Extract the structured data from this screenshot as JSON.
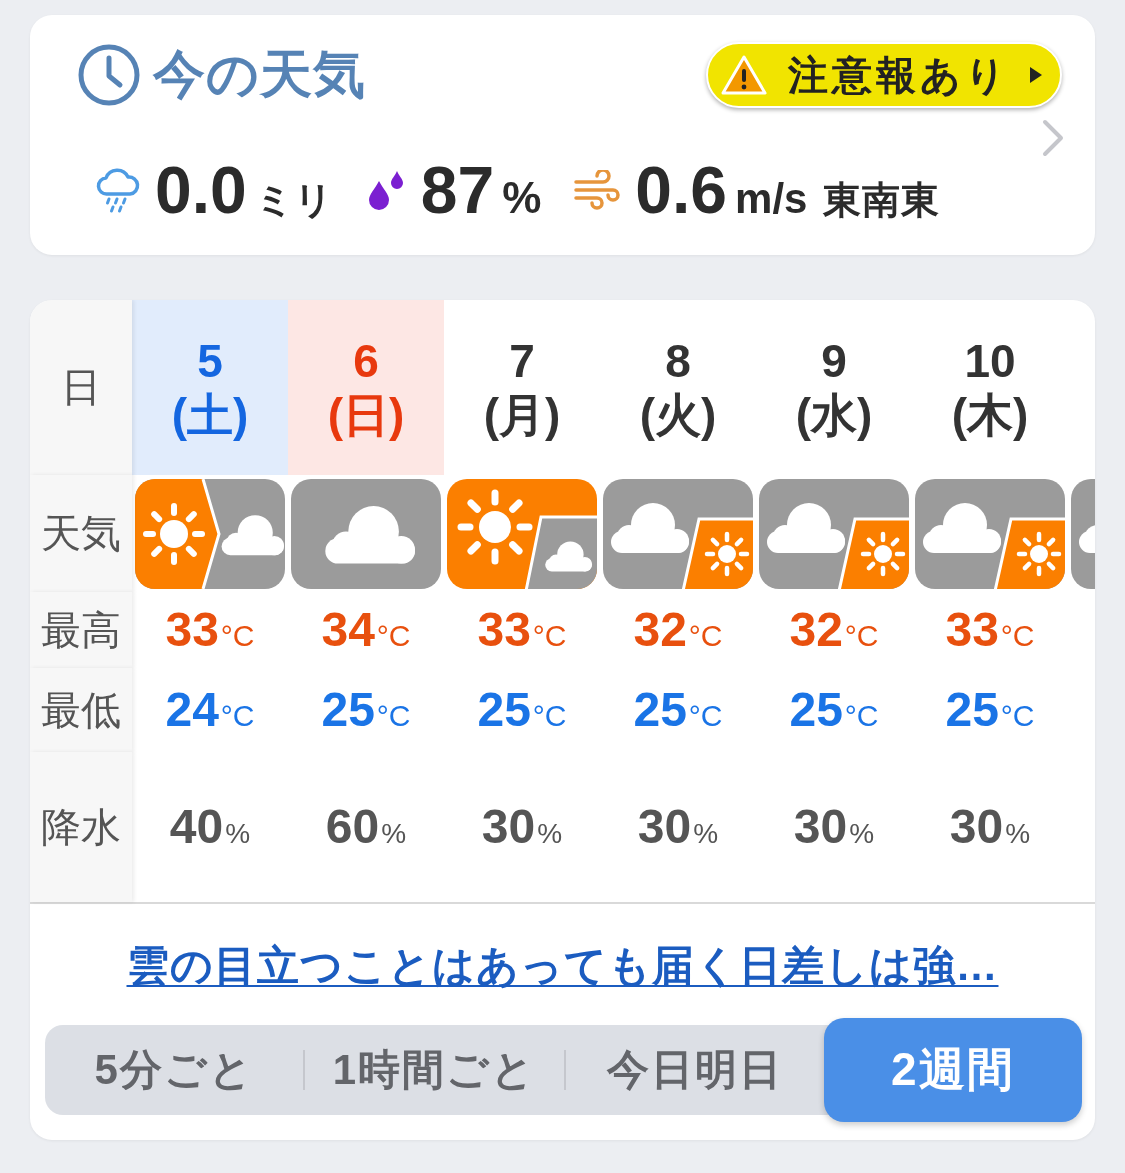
{
  "now": {
    "title": "今の天気",
    "warning": {
      "label": "注意報あり"
    },
    "metrics": [
      {
        "kind": "rain",
        "value": "0.0",
        "unit": "ミリ"
      },
      {
        "kind": "humidity",
        "value": "87",
        "unit": "%"
      },
      {
        "kind": "wind",
        "value": "0.6",
        "unit": "m/s",
        "direction": "東南東"
      }
    ]
  },
  "forecast": {
    "rows": [
      {
        "kind": "date",
        "label": "日"
      },
      {
        "kind": "weather",
        "label": "天気"
      },
      {
        "kind": "high",
        "label": "最高"
      },
      {
        "kind": "low",
        "label": "最低"
      },
      {
        "kind": "precip",
        "label": "降水"
      }
    ],
    "days": [
      {
        "date": "5",
        "weekday": "(土)",
        "kind": "saturday",
        "weather": {
          "kind": "sun-then-cloud"
        },
        "high": {
          "value": "33",
          "unit": "°C"
        },
        "low": {
          "value": "24",
          "unit": "°C"
        },
        "precip": {
          "value": "40",
          "unit": "%"
        }
      },
      {
        "date": "6",
        "weekday": "(日)",
        "kind": "sunday",
        "weather": {
          "kind": "cloud"
        },
        "high": {
          "value": "34",
          "unit": "°C"
        },
        "low": {
          "value": "25",
          "unit": "°C"
        },
        "precip": {
          "value": "60",
          "unit": "%"
        }
      },
      {
        "date": "7",
        "weekday": "(月)",
        "kind": "weekday",
        "weather": {
          "kind": "sun-with-cloud"
        },
        "high": {
          "value": "33",
          "unit": "°C"
        },
        "low": {
          "value": "25",
          "unit": "°C"
        },
        "precip": {
          "value": "30",
          "unit": "%"
        }
      },
      {
        "date": "8",
        "weekday": "(火)",
        "kind": "weekday",
        "weather": {
          "kind": "cloud-with-sun"
        },
        "high": {
          "value": "32",
          "unit": "°C"
        },
        "low": {
          "value": "25",
          "unit": "°C"
        },
        "precip": {
          "value": "30",
          "unit": "%"
        }
      },
      {
        "date": "9",
        "weekday": "(水)",
        "kind": "weekday",
        "weather": {
          "kind": "cloud-with-sun"
        },
        "high": {
          "value": "32",
          "unit": "°C"
        },
        "low": {
          "value": "25",
          "unit": "°C"
        },
        "precip": {
          "value": "30",
          "unit": "%"
        }
      },
      {
        "date": "10",
        "weekday": "(木)",
        "kind": "weekday",
        "weather": {
          "kind": "cloud-with-sun"
        },
        "high": {
          "value": "33",
          "unit": "°C"
        },
        "low": {
          "value": "25",
          "unit": "°C"
        },
        "precip": {
          "value": "30",
          "unit": "%"
        }
      }
    ],
    "next_day": {
      "weather": {
        "kind": "cloud-with-sun"
      }
    }
  },
  "summary_link": "雲の目立つことはあっても届く日差しは強…",
  "tabs": [
    {
      "label": "5分ごと",
      "selected": false
    },
    {
      "label": "1時間ごと",
      "selected": false
    },
    {
      "label": "今日明日",
      "selected": false
    },
    {
      "label": "2週間",
      "selected": true
    }
  ]
}
